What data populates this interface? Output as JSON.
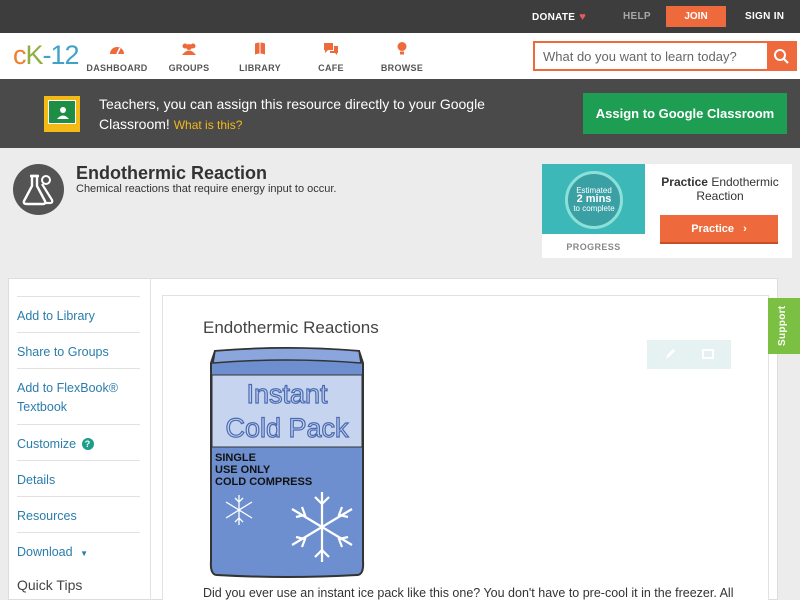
{
  "topbar": {
    "donate": "DONATE",
    "help": "HELP",
    "join": "JOIN",
    "signin": "SIGN IN"
  },
  "logo": {
    "part1": "c",
    "part2": "K",
    "part3": "-12"
  },
  "nav": {
    "items": [
      {
        "label": "DASHBOARD",
        "icon": "dashboard-icon"
      },
      {
        "label": "GROUPS",
        "icon": "groups-icon"
      },
      {
        "label": "LIBRARY",
        "icon": "library-icon"
      },
      {
        "label": "CAFE",
        "icon": "cafe-icon"
      },
      {
        "label": "BROWSE",
        "icon": "browse-icon"
      }
    ],
    "search_placeholder": "What do you want to learn today?"
  },
  "banner": {
    "text": "Teachers, you can assign this resource directly to your Google Classroom!",
    "link": "What is this?",
    "button": "Assign to Google Classroom"
  },
  "concept": {
    "title": "Endothermic Reaction",
    "subtitle": "Chemical reactions that require energy input to occur."
  },
  "practice": {
    "estimated": "Estimated",
    "mins": "2 mins",
    "to_complete": "to complete",
    "progress_label": "PROGRESS",
    "title_bold": "Practice",
    "title_rest": "Endothermic Reaction",
    "button": "Practice"
  },
  "sidebar": {
    "items": [
      {
        "label": "Add to Library"
      },
      {
        "label": "Share to Groups"
      },
      {
        "label": "Add to FlexBook® Textbook"
      },
      {
        "label": "Customize"
      },
      {
        "label": "Details"
      },
      {
        "label": "Resources"
      },
      {
        "label": "Download"
      }
    ],
    "quick_tips": "Quick Tips"
  },
  "article": {
    "title": "Endothermic Reactions",
    "image_text_line1": "Instant",
    "image_text_line2": "Cold Pack",
    "image_label1": "SINGLE",
    "image_label2": "USE ONLY",
    "image_label3": "COLD COMPRESS",
    "intro": "Did you ever use an instant ice pack like this one? You don't have to pre-cool it in the freezer. All"
  },
  "support_tab": "Support",
  "colors": {
    "accent_orange": "#ee6a3c",
    "topbar_bg": "#3d3d3d",
    "banner_bg": "#4a4a4a",
    "assign_green": "#1e9e52",
    "link_blue": "#2a7dab",
    "support_green": "#7bc043"
  }
}
